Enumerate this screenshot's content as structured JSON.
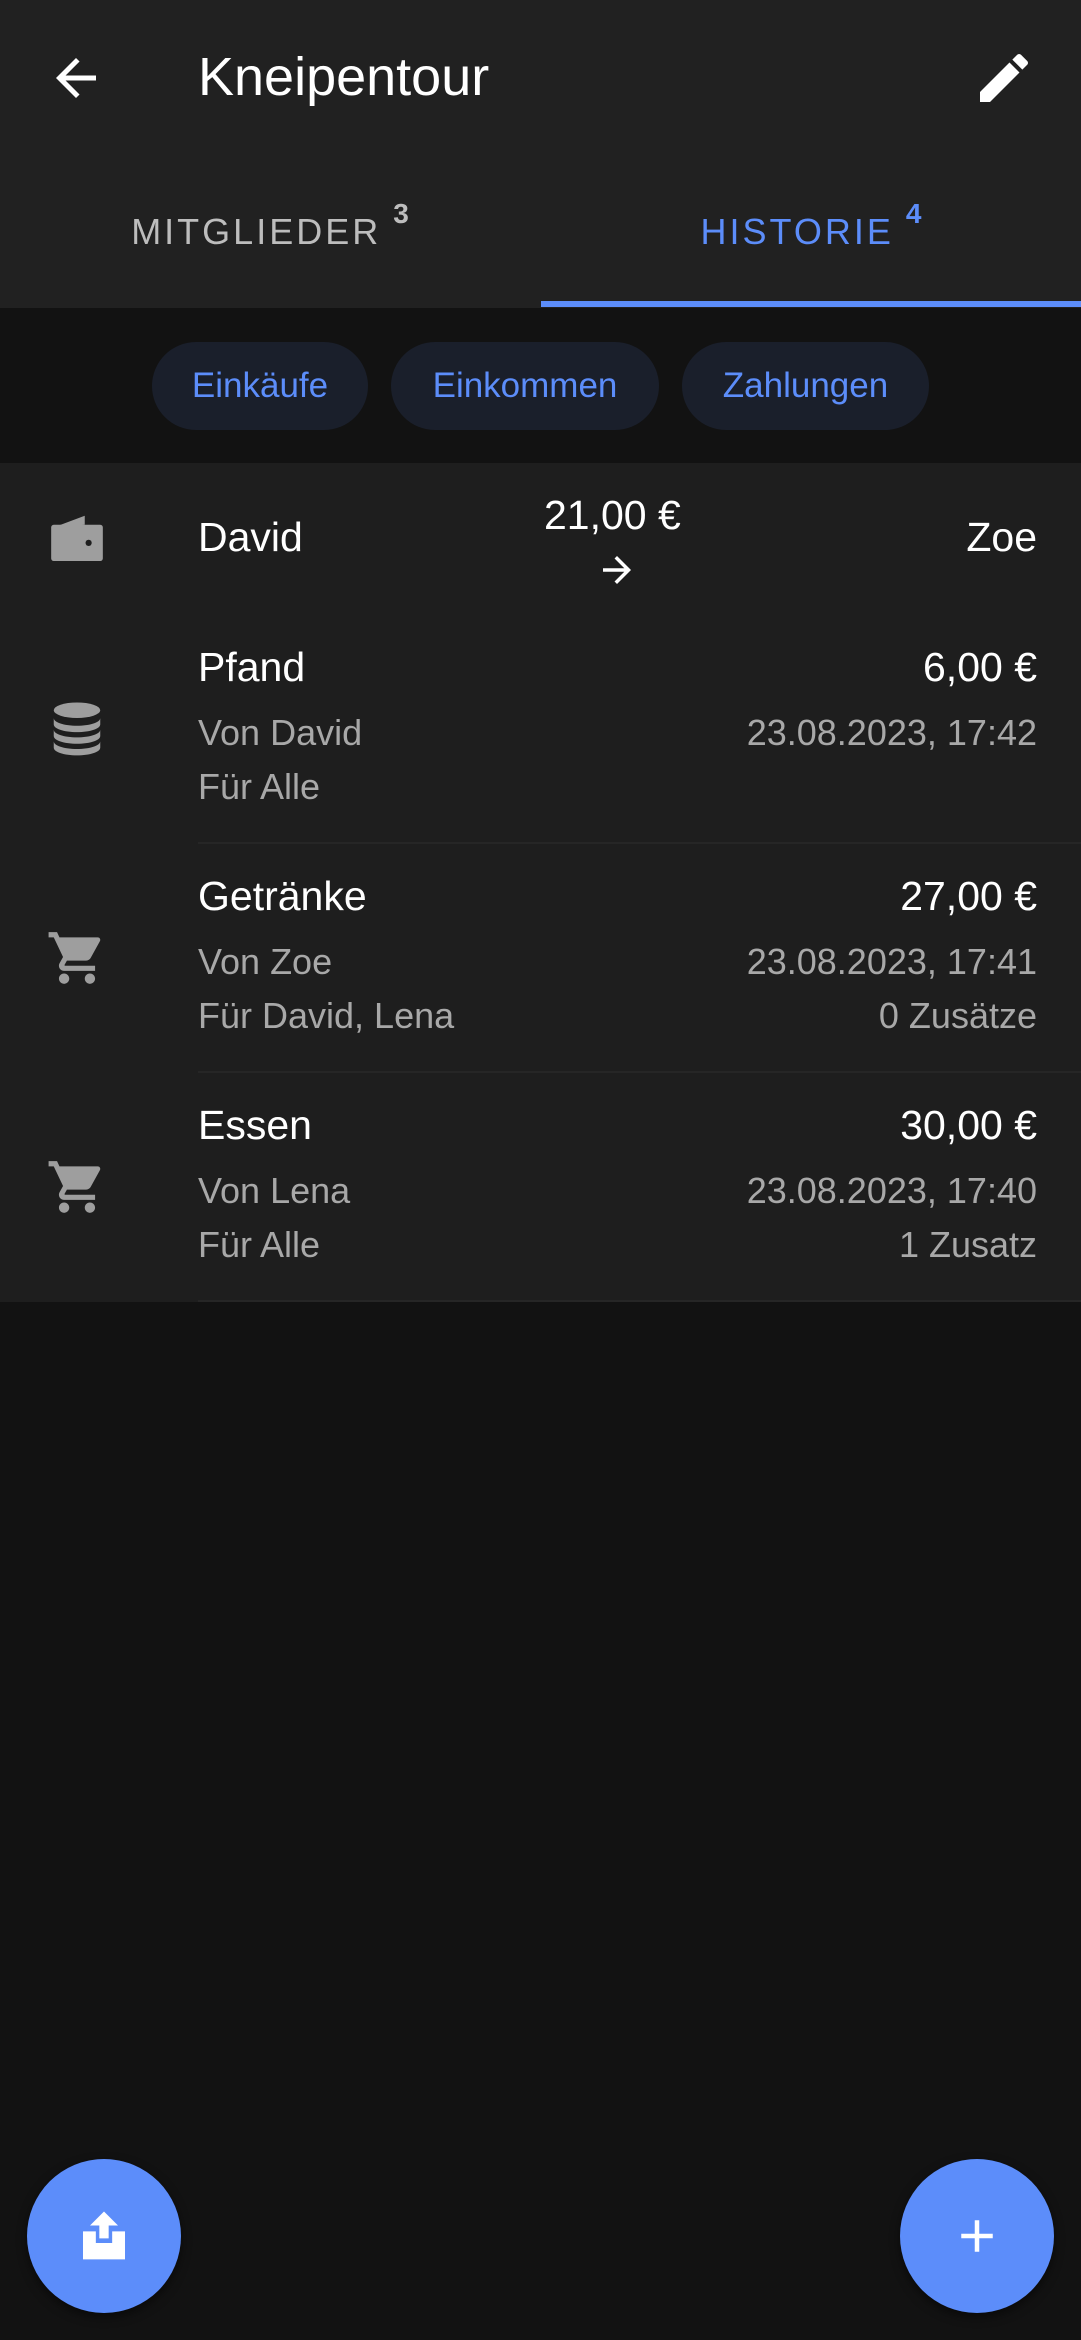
{
  "appbar": {
    "title": "Kneipentour",
    "back_icon": "arrow-back-icon",
    "edit_icon": "pencil-icon"
  },
  "tabs": [
    {
      "label": "MITGLIEDER",
      "count": "3",
      "selected": false
    },
    {
      "label": "HISTORIE",
      "count": "4",
      "selected": true
    }
  ],
  "filters": [
    "Einkäufe",
    "Einkommen",
    "Zahlungen"
  ],
  "payment": {
    "from": "David",
    "amount": "21,00 €",
    "to": "Zoe",
    "icon": "wallet-icon"
  },
  "items": [
    {
      "title": "Pfand",
      "amount": "6,00 €",
      "by": "Von David",
      "date": "23.08.2023, 17:42",
      "for": "Für Alle",
      "extras": "",
      "icon": "coins-stack-icon"
    },
    {
      "title": "Getränke",
      "amount": "27,00 €",
      "by": "Von Zoe",
      "date": "23.08.2023, 17:41",
      "for": "Für David, Lena",
      "extras": "0 Zusätze",
      "icon": "cart-icon"
    },
    {
      "title": "Essen",
      "amount": "30,00 €",
      "by": "Von Lena",
      "date": "23.08.2023, 17:40",
      "for": "Für Alle",
      "extras": "1 Zusatz",
      "icon": "cart-icon"
    }
  ],
  "fabs": {
    "share_icon": "share-upload-icon",
    "add_icon": "plus-icon"
  },
  "colors": {
    "accent": "#5c8dfa",
    "background": "#121212",
    "surface": "#212121"
  }
}
